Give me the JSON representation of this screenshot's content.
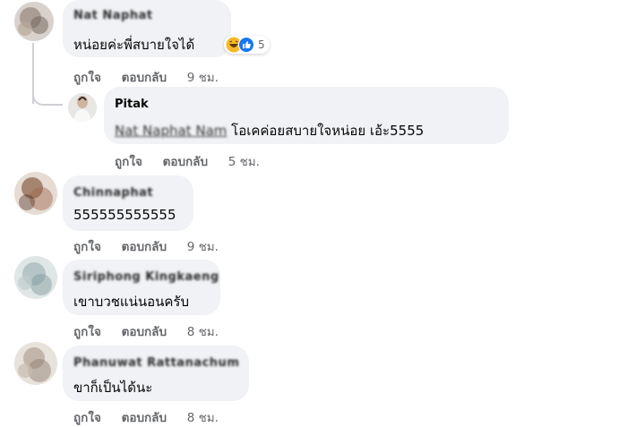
{
  "colors": {
    "bubble": "#f0f2f5",
    "meta_text": "#65676b",
    "like_blue": "#1877f2",
    "haha_yellow": "#f7b928"
  },
  "comments": [
    {
      "author": "Nat Naphat",
      "text": "หน่อยค่ะพี่สบายใจได้",
      "reactions_count": "5",
      "actions": {
        "like": "ถูกใจ",
        "reply": "ตอบกลับ",
        "time": "9 ชม."
      }
    },
    {
      "author": "Pitak",
      "mention": "Nat Naphat Nam",
      "text": "โอเคค่อยสบายใจหน่อย เอ้ะ5555",
      "actions": {
        "like": "ถูกใจ",
        "reply": "ตอบกลับ",
        "time": "5 ชม."
      }
    },
    {
      "author": "Chinnaphat",
      "text": "555555555555",
      "actions": {
        "like": "ถูกใจ",
        "reply": "ตอบกลับ",
        "time": "9 ชม."
      }
    },
    {
      "author": "Siriphong Kingkaeng",
      "text": "เขาบวชแน่นอนครับ",
      "actions": {
        "like": "ถูกใจ",
        "reply": "ตอบกลับ",
        "time": "8 ชม."
      }
    },
    {
      "author": "Phanuwat Rattanachum",
      "text": "ขาก็เป็นได้นะ",
      "actions": {
        "like": "ถูกใจ",
        "reply": "ตอบกลับ",
        "time": "8 ชม."
      }
    }
  ]
}
